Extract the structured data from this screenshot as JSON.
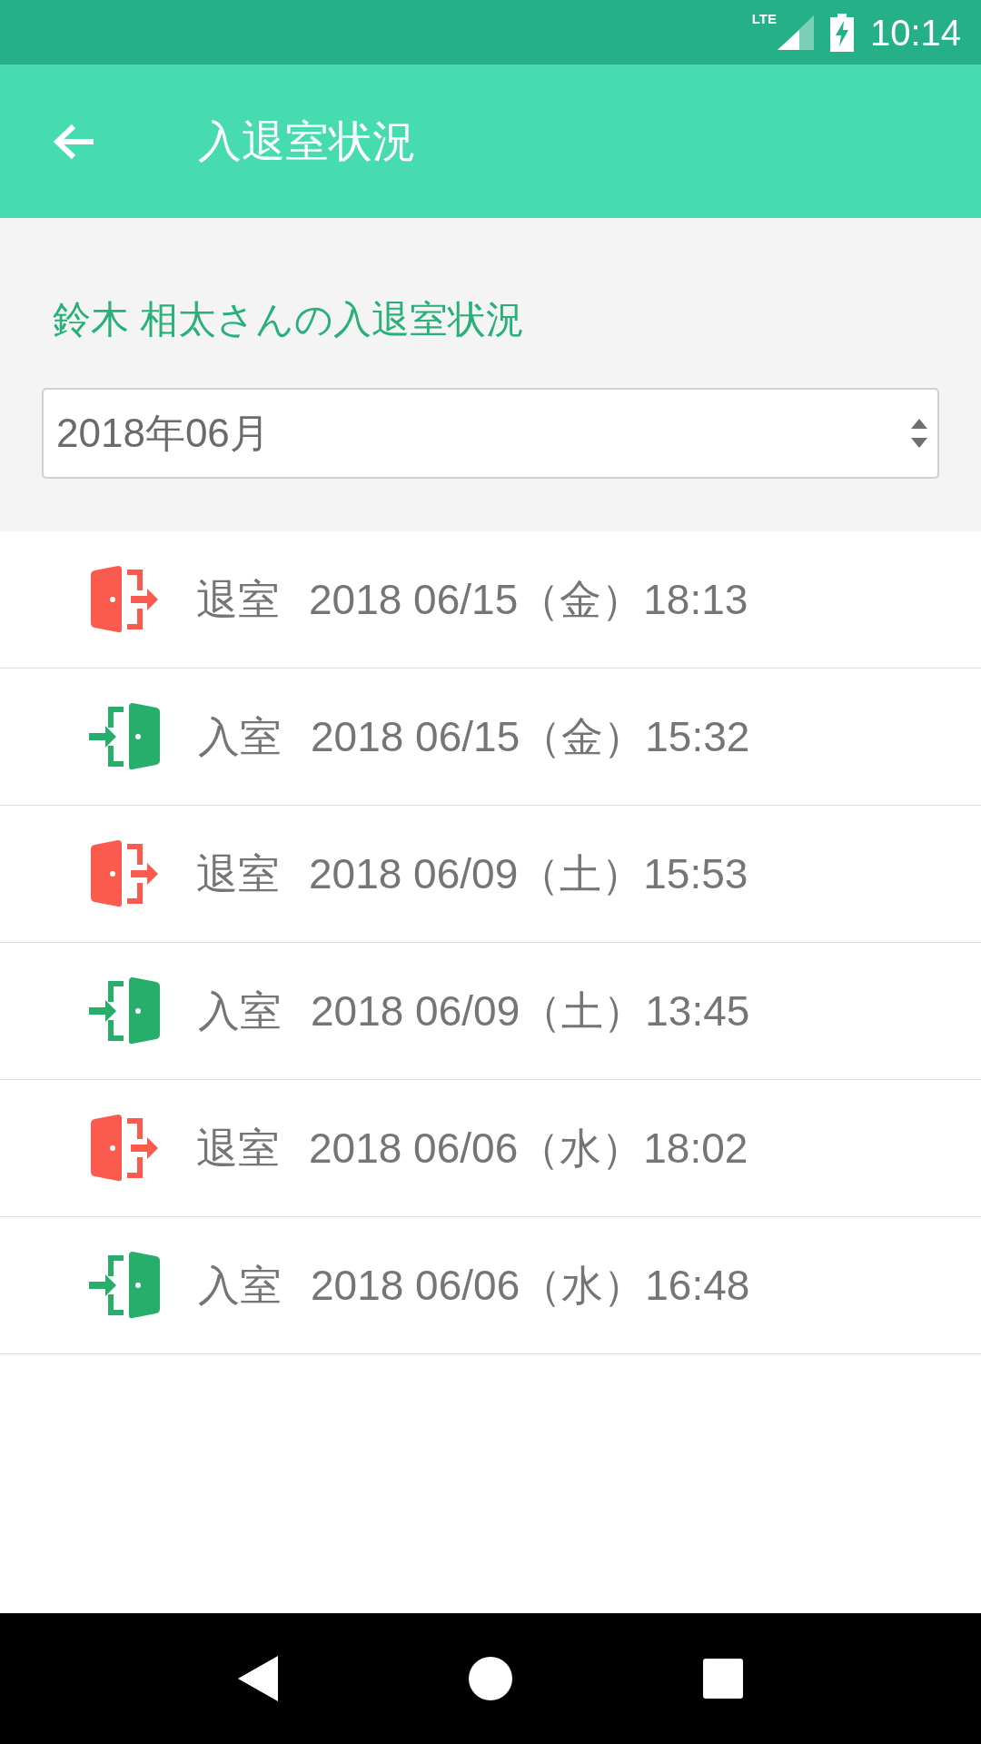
{
  "status_bar": {
    "network": "LTE",
    "time": "10:14"
  },
  "app_bar": {
    "title": "入退室状況"
  },
  "heading": "鈴木 相太さんの入退室状況",
  "month_select": {
    "value": "2018年06月"
  },
  "records": [
    {
      "kind": "exit",
      "label": "退室",
      "datetime": "2018 06/15（金）18:13"
    },
    {
      "kind": "enter",
      "label": "入室",
      "datetime": "2018 06/15（金）15:32"
    },
    {
      "kind": "exit",
      "label": "退室",
      "datetime": "2018 06/09（土）15:53"
    },
    {
      "kind": "enter",
      "label": "入室",
      "datetime": "2018 06/09（土）13:45"
    },
    {
      "kind": "exit",
      "label": "退室",
      "datetime": "2018 06/06（水）18:02"
    },
    {
      "kind": "enter",
      "label": "入室",
      "datetime": "2018 06/06（水）16:48"
    }
  ]
}
